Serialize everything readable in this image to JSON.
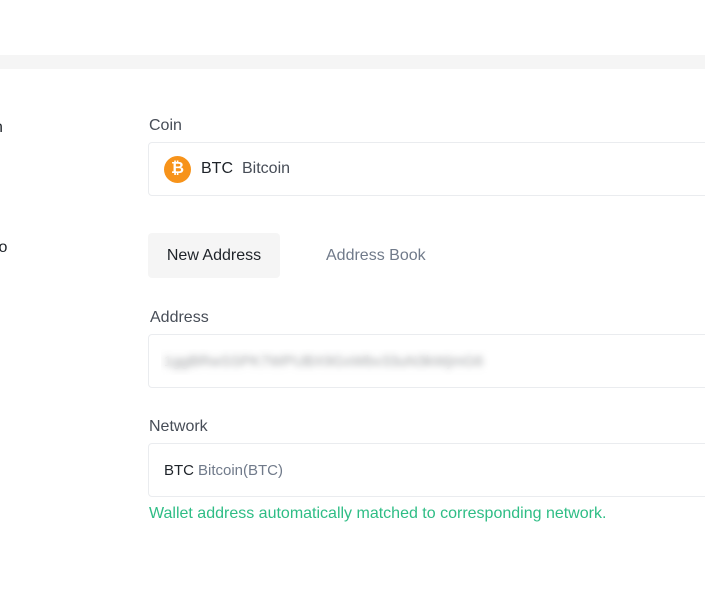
{
  "steps": {
    "step1_label": "n",
    "step2_label": "to"
  },
  "coin": {
    "label": "Coin",
    "icon": "bitcoin-icon",
    "icon_glyph": "₿",
    "icon_color": "#f7931a",
    "symbol": "BTC",
    "name": "Bitcoin"
  },
  "tabs": {
    "new_address": "New Address",
    "address_book": "Address Book"
  },
  "address": {
    "label": "Address",
    "value": "1ggBRwSSPK7WPUBX9GxWbv33uN3kWjmG6"
  },
  "network": {
    "label": "Network",
    "symbol": "BTC",
    "name": "Bitcoin(BTC)"
  },
  "hint": {
    "text": "Wallet address automatically matched to corresponding network.",
    "color": "#2ebd85"
  }
}
